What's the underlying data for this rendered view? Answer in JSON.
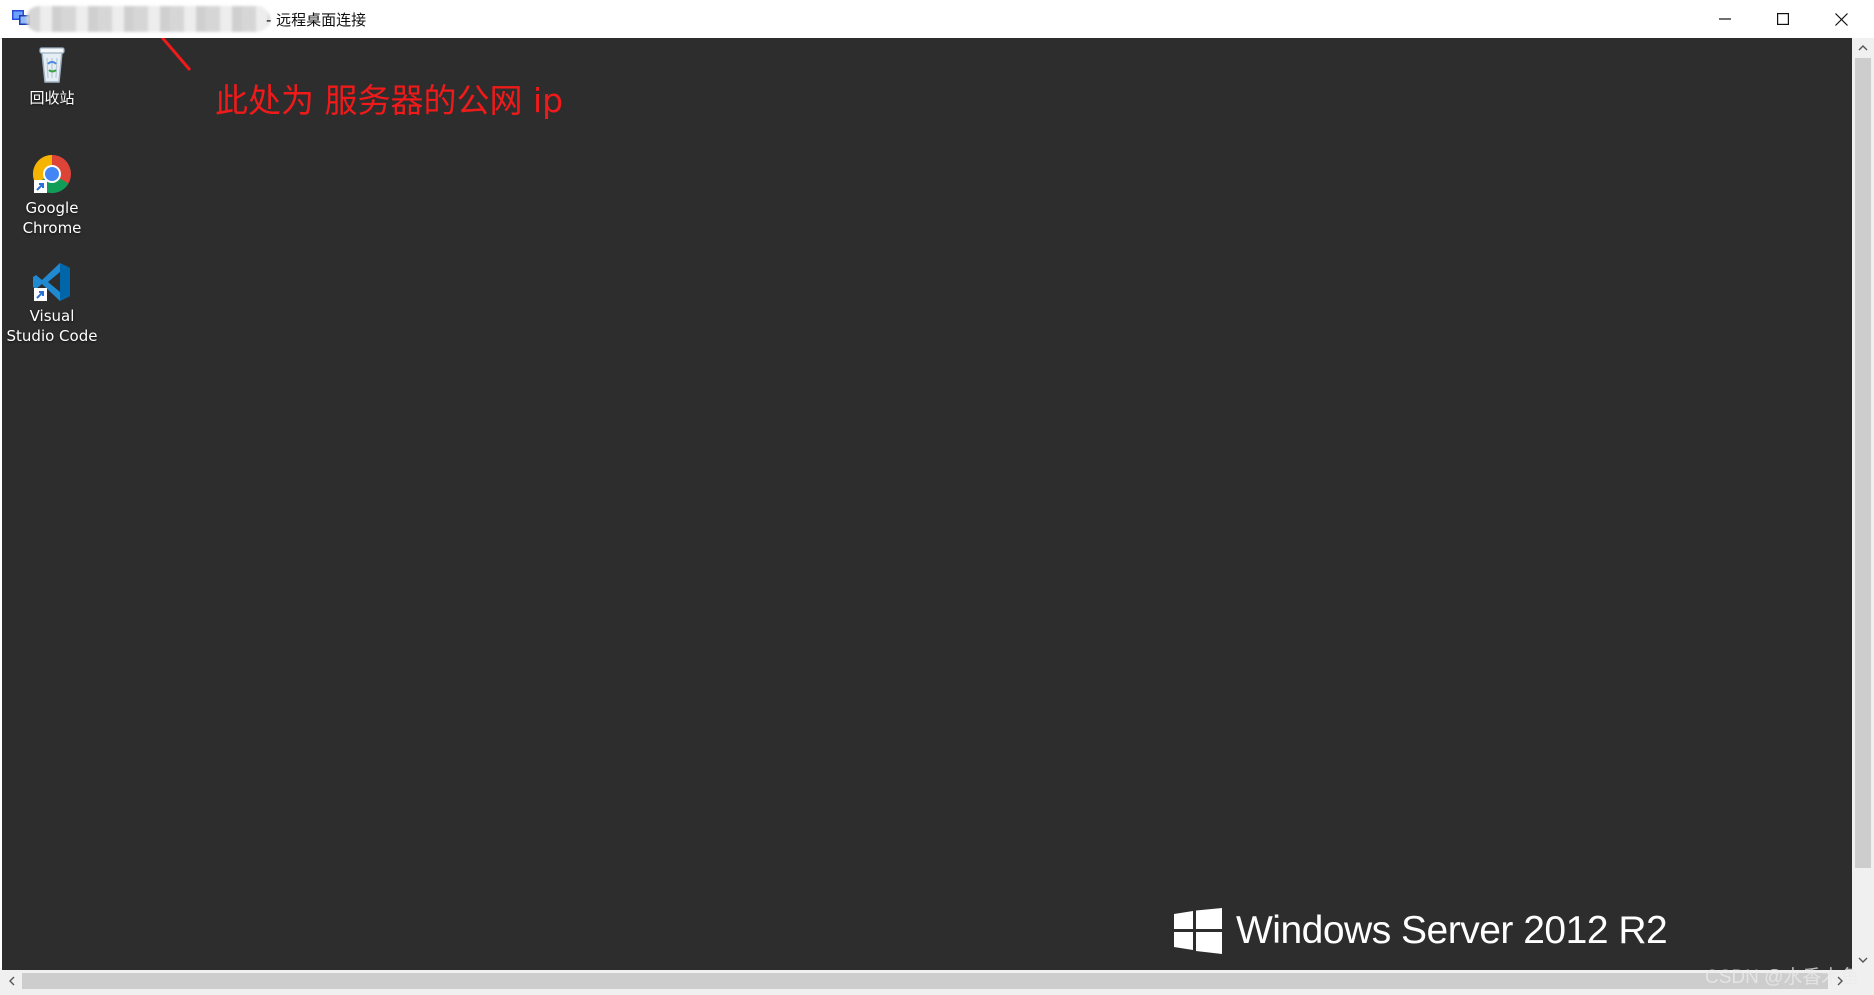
{
  "window": {
    "title_suffix": "- 远程桌面连接",
    "controls": {
      "minimize_icon": "minimize-icon",
      "maximize_icon": "maximize-icon",
      "close_icon": "close-icon"
    }
  },
  "desktop": {
    "background": "#2d2d2d",
    "icons": [
      {
        "label": "回收站",
        "icon": "recycle-bin-icon"
      },
      {
        "label": "Google Chrome",
        "icon": "chrome-icon"
      },
      {
        "label": "Visual Studio Code",
        "icon": "vscode-icon"
      }
    ],
    "annotation": {
      "text": "此处为 服务器的公网 ip",
      "color": "#f01a1a"
    },
    "branding": {
      "text": "Windows Server 2012 R2",
      "icon": "windows-logo-icon"
    },
    "watermark": "CSDN @水香木鱼"
  }
}
